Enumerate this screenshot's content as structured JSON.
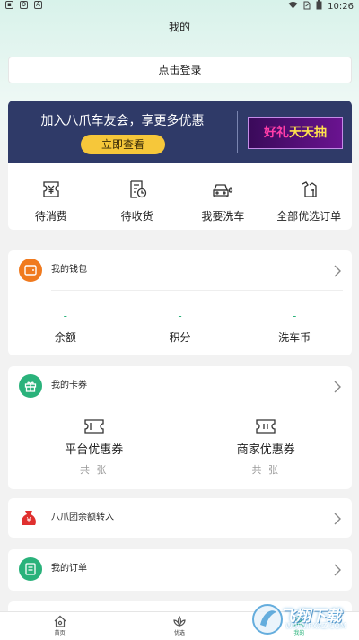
{
  "status_bar": {
    "time": "10:26"
  },
  "header": {
    "title": "我的",
    "login_label": "点击登录"
  },
  "banner": {
    "text": "加入八爪车友会，享更多优惠",
    "button_label": "立即查看",
    "promo_a": "好礼",
    "promo_b": "天天抽"
  },
  "quick_actions": [
    {
      "label": "待消费",
      "icon": "ticket-icon"
    },
    {
      "label": "待收货",
      "icon": "clock-receipt-icon"
    },
    {
      "label": "我要洗车",
      "icon": "car-wash-icon"
    },
    {
      "label": "全部优选订单",
      "icon": "shirt-bag-icon"
    }
  ],
  "wallet": {
    "title": "我的钱包",
    "stats": [
      {
        "value": "-",
        "label": "余额"
      },
      {
        "value": "-",
        "label": "积分"
      },
      {
        "value": "-",
        "label": "洗车币"
      }
    ],
    "accent": "#f07a1e"
  },
  "coupons": {
    "title": "我的卡券",
    "items": [
      {
        "label": "平台优惠券",
        "sub": "共  张"
      },
      {
        "label": "商家优惠券",
        "sub": "共  张"
      }
    ],
    "accent": "#2ab27b"
  },
  "transfer": {
    "title": "八爪团余额转入",
    "accent": "#e0302f"
  },
  "orders": {
    "title": "我的订单",
    "accent": "#2ab27b"
  },
  "tabbar": [
    {
      "label": "首页",
      "icon": "home-icon",
      "active": false
    },
    {
      "label": "优选",
      "icon": "lotus-icon",
      "active": false
    },
    {
      "label": "我的",
      "icon": "profile-icon",
      "active": true
    }
  ],
  "watermark": {
    "text": "飞翔下载",
    "url": "WWW.FXXZ.COM"
  }
}
